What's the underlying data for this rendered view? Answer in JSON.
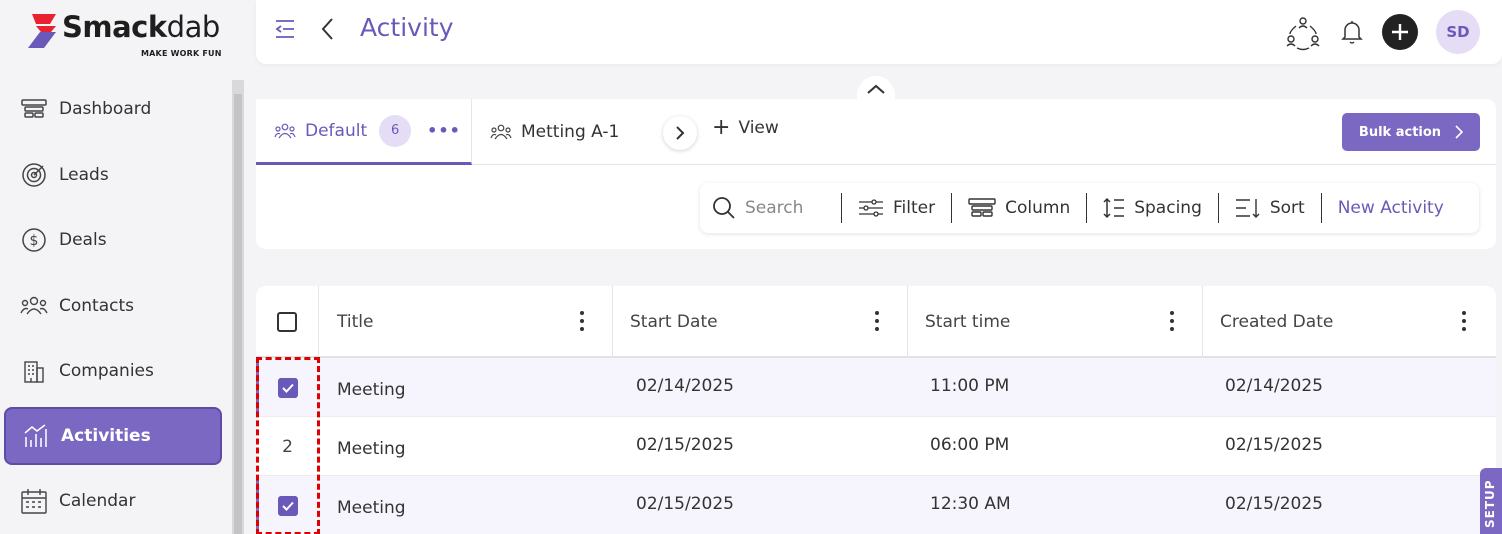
{
  "brand": {
    "name_bold": "Smack",
    "name_light": "dab",
    "tagline": "MAKE WORK FUN",
    "accent": "#7a68c2",
    "logo_red": "#e8232f",
    "logo_purple": "#6a59b9"
  },
  "sidebar": {
    "items": [
      {
        "label": "Dashboard",
        "icon": "dashboard-icon",
        "active": false
      },
      {
        "label": "Leads",
        "icon": "target-icon",
        "active": false
      },
      {
        "label": "Deals",
        "icon": "dollar-icon",
        "active": false
      },
      {
        "label": "Contacts",
        "icon": "contacts-icon",
        "active": false
      },
      {
        "label": "Companies",
        "icon": "building-icon",
        "active": false
      },
      {
        "label": "Activities",
        "icon": "activity-chart-icon",
        "active": true
      },
      {
        "label": "Calendar",
        "icon": "calendar-icon",
        "active": false
      }
    ]
  },
  "header": {
    "title": "Activity",
    "avatar_initials": "SD"
  },
  "views": {
    "tabs": [
      {
        "label": "Default",
        "count": "6",
        "active": true
      },
      {
        "label": "Metting A-1",
        "active": false
      }
    ],
    "add_view_label": "View",
    "bulk_action_label": "Bulk action"
  },
  "toolbar": {
    "search_placeholder": "Search",
    "filter_label": "Filter",
    "column_label": "Column",
    "spacing_label": "Spacing",
    "sort_label": "Sort",
    "new_activity_label": "New Activity"
  },
  "table": {
    "columns": [
      "Title",
      "Start Date",
      "Start time",
      "Created Date"
    ],
    "rows": [
      {
        "marker": "checked",
        "title": "Meeting",
        "start_date": "02/14/2025",
        "start_time": "11:00 PM",
        "created_date": "02/14/2025"
      },
      {
        "marker": "2",
        "title": "Meeting",
        "start_date": "02/15/2025",
        "start_time": "06:00 PM",
        "created_date": "02/15/2025"
      },
      {
        "marker": "checked",
        "title": "Meeting",
        "start_date": "02/15/2025",
        "start_time": "12:30 AM",
        "created_date": "02/15/2025"
      }
    ]
  },
  "setup_tab_label": "SETUP"
}
